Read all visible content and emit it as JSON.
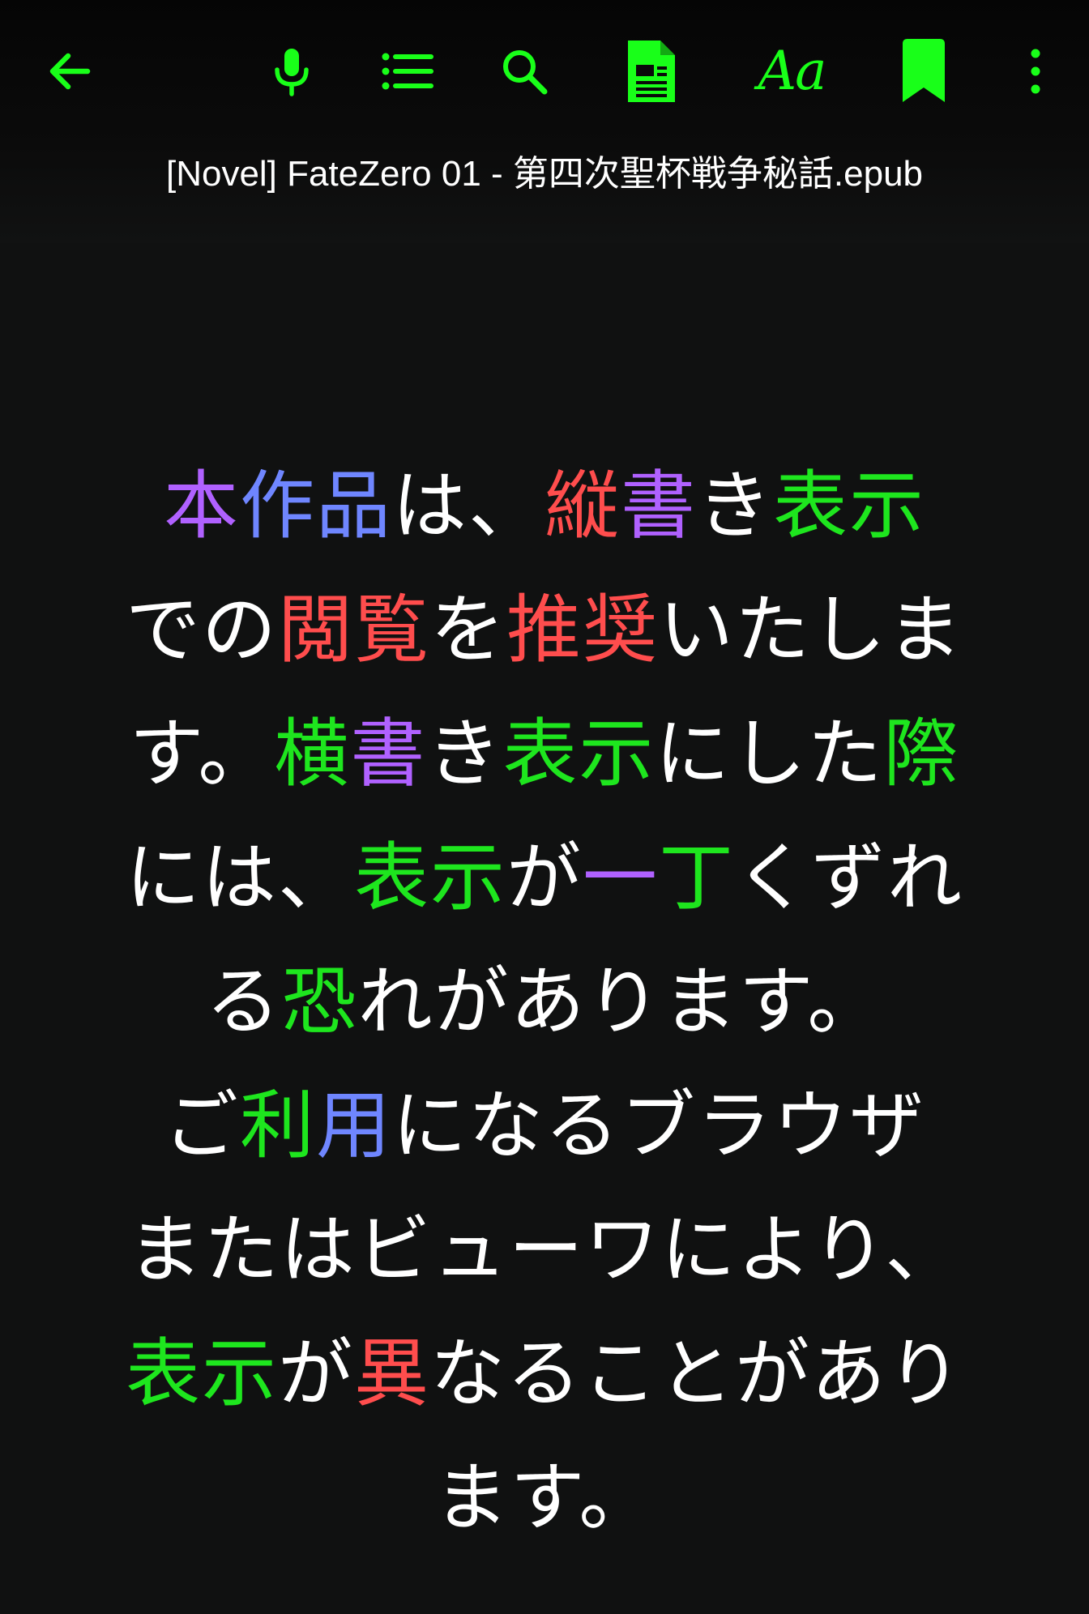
{
  "colors": {
    "accent": "#19ff19",
    "background": "#101111",
    "text_default": "#ffffff",
    "purple": "#b061ff",
    "blue": "#6f86ff",
    "red": "#ff4d4d",
    "green": "#1ee61e"
  },
  "toolbar": {
    "back_icon": "arrow-left-icon",
    "mic_icon": "microphone-icon",
    "toc_icon": "list-icon",
    "search_icon": "search-icon",
    "doc_icon": "document-icon",
    "font_label": "Aa",
    "bookmark_icon": "bookmark-icon",
    "more_icon": "more-vertical-icon"
  },
  "book": {
    "title": "[Novel] FateZero 01 - 第四次聖杯戦争秘話.epub"
  },
  "content": {
    "lines": [
      [
        {
          "text": "本",
          "color": "purple"
        },
        {
          "text": "作",
          "color": "blue"
        },
        {
          "text": "品",
          "color": "blue"
        },
        {
          "text": "は、",
          "color": "white"
        },
        {
          "text": "縦",
          "color": "red"
        },
        {
          "text": "書",
          "color": "purple"
        },
        {
          "text": "き",
          "color": "white"
        },
        {
          "text": "表示",
          "color": "green"
        }
      ],
      [
        {
          "text": "での",
          "color": "white"
        },
        {
          "text": "閲覧",
          "color": "red"
        },
        {
          "text": "を",
          "color": "white"
        },
        {
          "text": "推",
          "color": "red"
        },
        {
          "text": "奨",
          "color": "red"
        },
        {
          "text": "いたしま",
          "color": "white"
        }
      ],
      [
        {
          "text": "す。",
          "color": "white"
        },
        {
          "text": "横",
          "color": "green"
        },
        {
          "text": "書",
          "color": "purple"
        },
        {
          "text": "き",
          "color": "white"
        },
        {
          "text": "表示",
          "color": "green"
        },
        {
          "text": "にした",
          "color": "white"
        },
        {
          "text": "際",
          "color": "green"
        }
      ],
      [
        {
          "text": "には、",
          "color": "white"
        },
        {
          "text": "表示",
          "color": "green"
        },
        {
          "text": "が",
          "color": "white"
        },
        {
          "text": "一",
          "color": "purple"
        },
        {
          "text": "丁",
          "color": "green"
        },
        {
          "text": "くずれ",
          "color": "white"
        }
      ],
      [
        {
          "text": "る",
          "color": "white"
        },
        {
          "text": "恐",
          "color": "green"
        },
        {
          "text": "れがあります。",
          "color": "white"
        }
      ],
      [
        {
          "text": "ご",
          "color": "white"
        },
        {
          "text": "利",
          "color": "green"
        },
        {
          "text": "用",
          "color": "blue"
        },
        {
          "text": "になるブラウザ",
          "color": "white"
        }
      ],
      [
        {
          "text": "またはビューワにより、",
          "color": "white"
        }
      ],
      [
        {
          "text": "表示",
          "color": "green"
        },
        {
          "text": "が",
          "color": "white"
        },
        {
          "text": "異",
          "color": "red"
        },
        {
          "text": "なることがあり",
          "color": "white"
        }
      ],
      [
        {
          "text": "ます。",
          "color": "white"
        }
      ]
    ]
  }
}
